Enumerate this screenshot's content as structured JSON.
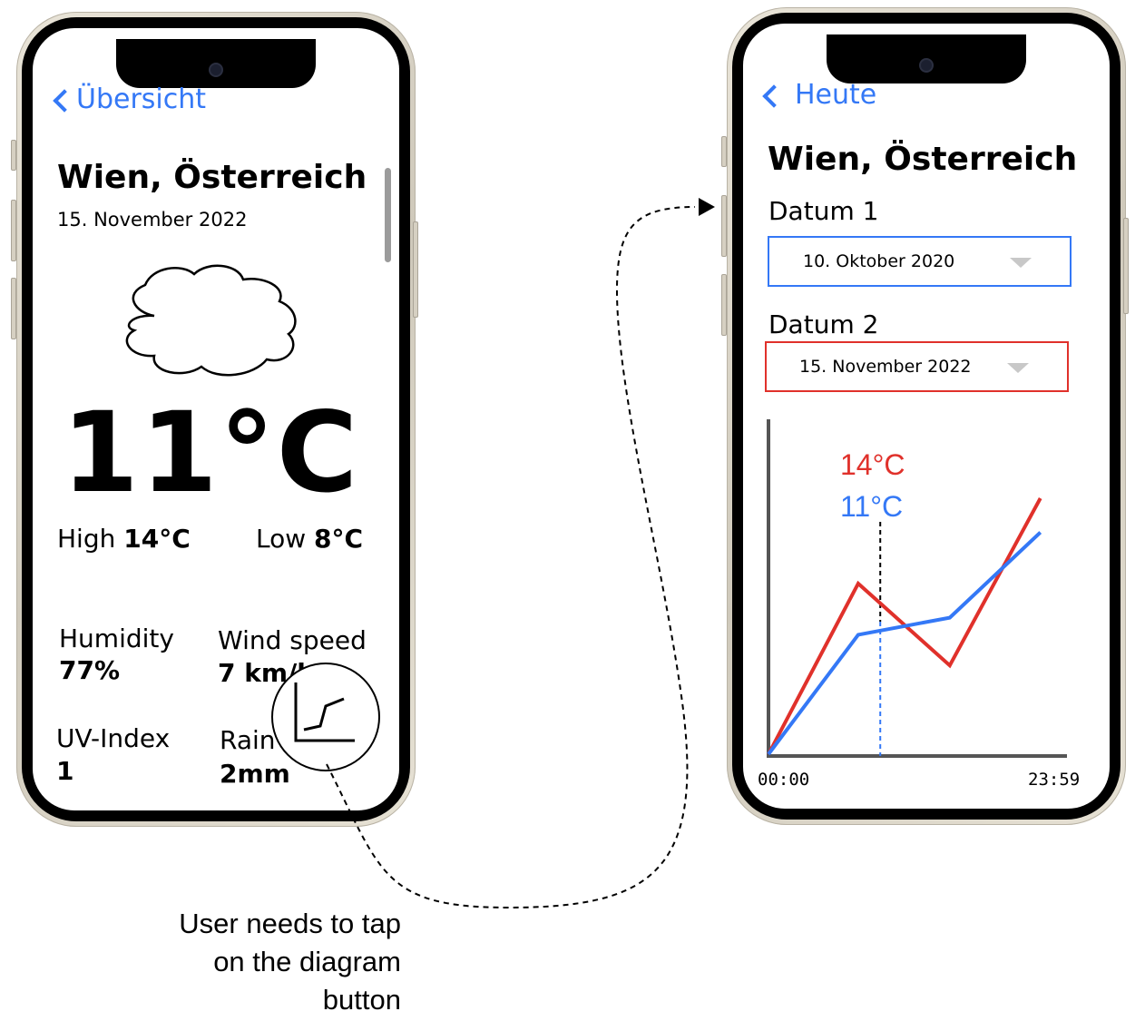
{
  "overview_screen": {
    "back_label": "Übersicht",
    "city": "Wien, Österreich",
    "date": "15. November 2022",
    "weather_icon": "cloud-icon",
    "temperature": "11°C",
    "high_label": "High",
    "high_value": "14°C",
    "low_label": "Low",
    "low_value": "8°C",
    "stats": {
      "humidity_label": "Humidity",
      "humidity_value": "77%",
      "wind_label": "Wind speed",
      "wind_value": "7 km/h",
      "uv_label": "UV-Index",
      "uv_value": "1",
      "rain_label": "Rain",
      "rain_value": "2mm"
    },
    "diagram_button_icon": "line-chart-icon"
  },
  "compare_screen": {
    "back_label": "Heute",
    "city": "Wien, Österreich",
    "datum1_label": "Datum 1",
    "datum1_value": "10. Oktober 2020",
    "datum2_label": "Datum 2",
    "datum2_value": "15. November 2022",
    "colors": {
      "datum1": "#3478f6",
      "datum2": "#e0312b"
    }
  },
  "chart_data": {
    "type": "line",
    "x_tick_labels": [
      "00:00",
      "23:59"
    ],
    "series": [
      {
        "color": "#e0312b",
        "values": [
          0,
          0.5,
          0.26,
          0.75
        ]
      },
      {
        "color": "#3478f6",
        "values": [
          0,
          0.35,
          0.4,
          0.65
        ]
      }
    ],
    "x_positions": [
      0,
      0.297,
      0.6,
      0.9
    ],
    "marker_x": 0.37,
    "marker_labels": {
      "datum2": "14°C",
      "datum1": "11°C"
    },
    "ylim": [
      0,
      1
    ]
  },
  "annotation": {
    "caption": [
      "User needs to tap",
      "on the diagram",
      "button"
    ]
  }
}
